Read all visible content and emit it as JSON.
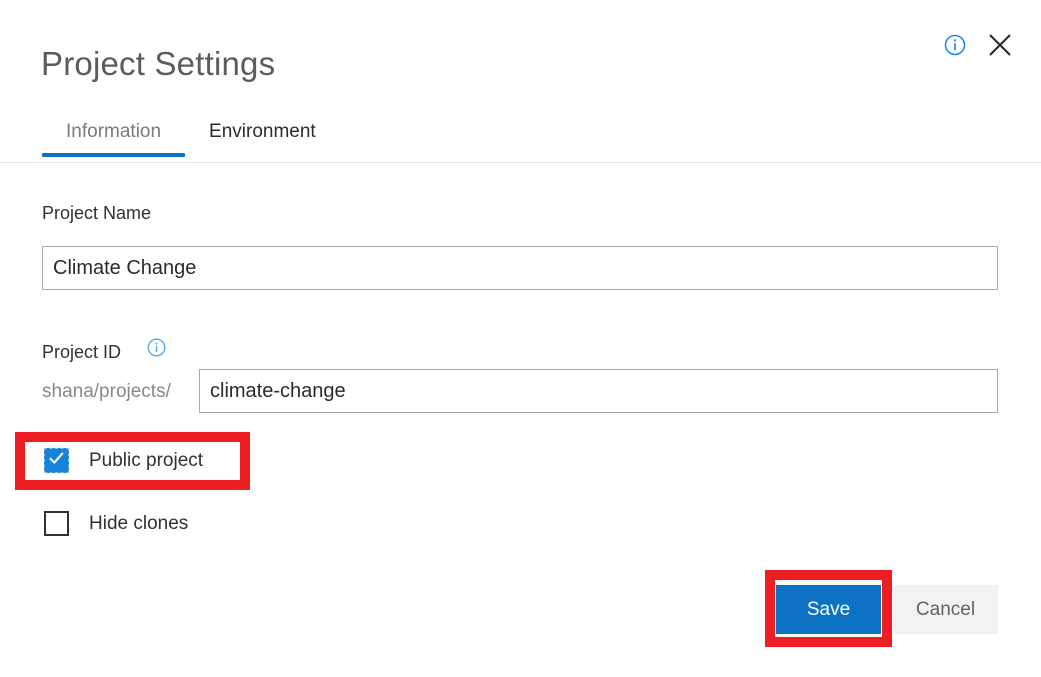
{
  "dialog": {
    "title": "Project Settings",
    "info_icon": "info-circle-icon",
    "close_icon": "close-x-icon"
  },
  "tabs": [
    {
      "label": "Information",
      "active": true
    },
    {
      "label": "Environment",
      "active": false
    }
  ],
  "fields": {
    "project_name": {
      "label": "Project Name",
      "value": "Climate Change",
      "placeholder": ""
    },
    "project_id": {
      "label": "Project ID",
      "info_icon": "info-circle-icon",
      "prefix": "shana/projects/",
      "value": "climate-change",
      "placeholder": ""
    }
  },
  "checkboxes": [
    {
      "label": "Public project",
      "checked": true,
      "highlighted": true
    },
    {
      "label": "Hide clones",
      "checked": false,
      "highlighted": false
    }
  ],
  "buttons": {
    "save": {
      "label": "Save",
      "highlighted": true
    },
    "cancel": {
      "label": "Cancel",
      "highlighted": false
    }
  },
  "colors": {
    "accent_blue": "#0d72c4",
    "checkbox_blue": "#1683d8",
    "annotation_red": "#ee1c23",
    "secondary_button_bg": "#f3f2f1",
    "title_gray": "#5c5c5c",
    "prefix_gray": "#8a8886",
    "divider_gray": "#ebe9e7",
    "input_border": "#a9a9a9"
  }
}
